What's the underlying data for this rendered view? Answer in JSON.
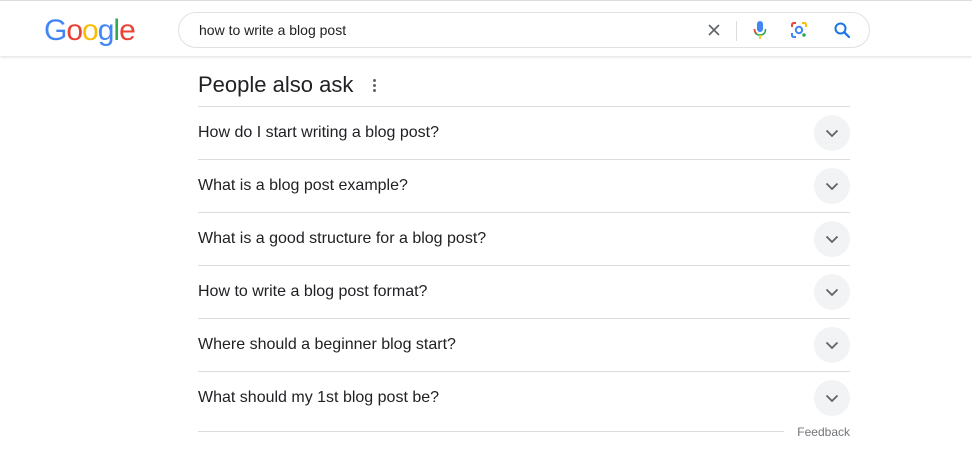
{
  "header": {
    "logo_letters": [
      {
        "char": "G",
        "color": "#4285F4"
      },
      {
        "char": "o",
        "color": "#EA4335"
      },
      {
        "char": "o",
        "color": "#FBBC05"
      },
      {
        "char": "g",
        "color": "#4285F4"
      },
      {
        "char": "l",
        "color": "#34A853"
      },
      {
        "char": "e",
        "color": "#EA4335"
      }
    ],
    "search": {
      "value": "how to write a blog post",
      "icons": [
        "clear-icon",
        "microphone-icon",
        "google-lens-icon",
        "search-icon"
      ]
    }
  },
  "paa": {
    "title": "People also ask",
    "questions": [
      "How do I start writing a blog post?",
      "What is a blog post example?",
      "What is a good structure for a blog post?",
      "How to write a blog post format?",
      "Where should a beginner blog start?",
      "What should my 1st blog post be?"
    ],
    "feedback_label": "Feedback"
  },
  "colors": {
    "text": "#202124",
    "divider": "#dadce0",
    "secondary": "#70757a",
    "chevron_bg": "#f1f3f4",
    "accent_blue": "#1a73e8"
  }
}
